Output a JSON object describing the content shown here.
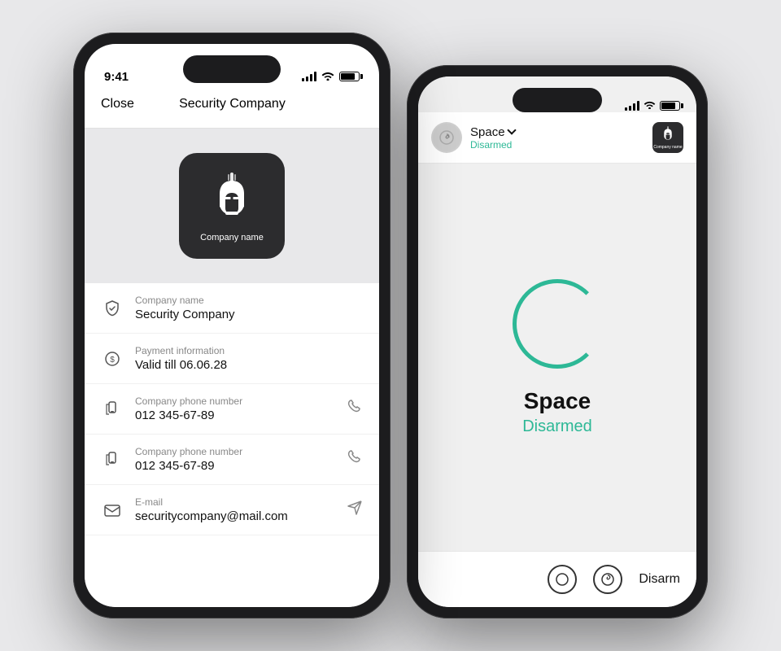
{
  "scene": {
    "background": "#e8e8ea"
  },
  "left_phone": {
    "status_bar": {
      "time": "9:41"
    },
    "nav": {
      "close_label": "Close",
      "title": "Security Company"
    },
    "logo": {
      "card_label": "Company name"
    },
    "info_items": [
      {
        "label": "Company name",
        "value": "Security Company",
        "icon": "shield-icon",
        "has_action": false
      },
      {
        "label": "Payment information",
        "value": "Valid till 06.06.28",
        "icon": "payment-icon",
        "has_action": false
      },
      {
        "label": "Company phone number",
        "value": "012 345-67-89",
        "icon": "phone-icon",
        "has_action": true
      },
      {
        "label": "Company phone number",
        "value": "012 345-67-89",
        "icon": "phone-icon",
        "has_action": true
      },
      {
        "label": "E-mail",
        "value": "securitycompany@mail.com",
        "icon": "email-icon",
        "has_action": true
      }
    ]
  },
  "right_phone": {
    "header": {
      "space_name": "Space",
      "status": "Disarmed",
      "company_label": "Company name"
    },
    "main": {
      "space_name": "Space",
      "status": "Disarmed"
    },
    "bottom": {
      "disarm_label": "Disarm"
    }
  }
}
